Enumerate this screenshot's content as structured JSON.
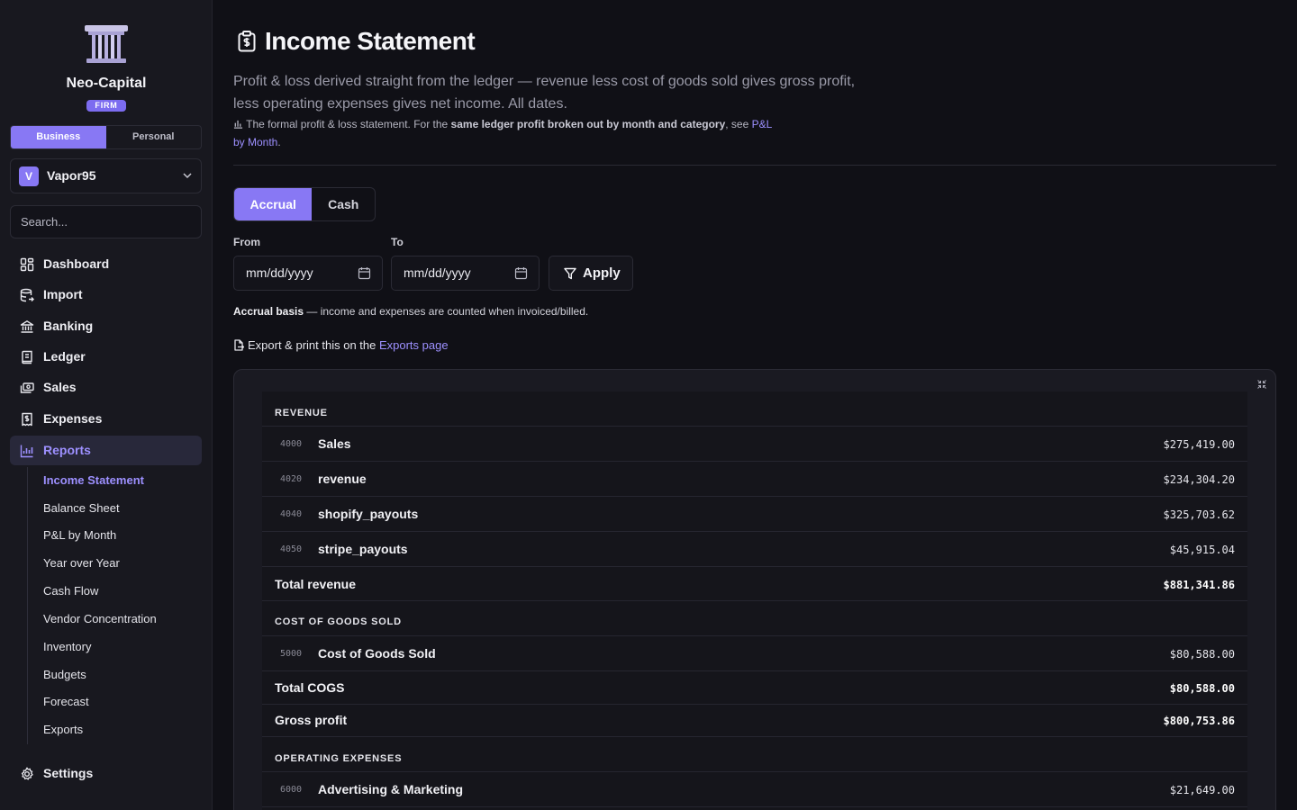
{
  "org": {
    "name": "Neo-Capital",
    "badge": "FIRM"
  },
  "mode_toggle": {
    "business": "Business",
    "personal": "Personal"
  },
  "account": {
    "initial": "V",
    "name": "Vapor95"
  },
  "search": {
    "placeholder": "Search..."
  },
  "nav": {
    "dashboard": "Dashboard",
    "import": "Import",
    "banking": "Banking",
    "ledger": "Ledger",
    "sales": "Sales",
    "expenses": "Expenses",
    "reports": "Reports",
    "settings": "Settings"
  },
  "reports_sub": {
    "income_statement": "Income Statement",
    "balance_sheet": "Balance Sheet",
    "pl_by_month": "P&L by Month",
    "year_over_year": "Year over Year",
    "cash_flow": "Cash Flow",
    "vendor_concentration": "Vendor Concentration",
    "inventory": "Inventory",
    "budgets": "Budgets",
    "forecast": "Forecast",
    "exports": "Exports"
  },
  "page": {
    "title": "Income Statement",
    "description": "Profit & loss derived straight from the ledger — revenue less cost of goods sold gives gross profit, less operating expenses gives net income. All dates.",
    "note_prefix": "The formal profit & loss statement. For the ",
    "note_bold": "same ledger profit broken out by month and category",
    "note_mid": ", see ",
    "note_link": "P&L by Month",
    "note_end": "."
  },
  "basis": {
    "accrual": "Accrual",
    "cash": "Cash"
  },
  "filters": {
    "from_label": "From",
    "to_label": "To",
    "from_value": "mm/dd/yyyy",
    "to_value": "mm/dd/yyyy",
    "apply": "Apply"
  },
  "basis_note": {
    "bold": "Accrual basis",
    "rest": " — income and expenses are counted when invoiced/billed."
  },
  "export": {
    "text": "Export & print this on the ",
    "link": "Exports page"
  },
  "statement": {
    "revenue": {
      "label": "REVENUE",
      "lines": [
        {
          "code": "4000",
          "name": "Sales",
          "amount": "$275,419.00"
        },
        {
          "code": "4020",
          "name": "revenue",
          "amount": "$234,304.20"
        },
        {
          "code": "4040",
          "name": "shopify_payouts",
          "amount": "$325,703.62"
        },
        {
          "code": "4050",
          "name": "stripe_payouts",
          "amount": "$45,915.04"
        }
      ],
      "total_label": "Total revenue",
      "total": "$881,341.86"
    },
    "cogs": {
      "label": "COST OF GOODS SOLD",
      "lines": [
        {
          "code": "5000",
          "name": "Cost of Goods Sold",
          "amount": "$80,588.00"
        }
      ],
      "total_label": "Total COGS",
      "total": "$80,588.00"
    },
    "gross_profit": {
      "label": "Gross profit",
      "amount": "$800,753.86"
    },
    "opex": {
      "label": "OPERATING EXPENSES",
      "lines": [
        {
          "code": "6000",
          "name": "Advertising & Marketing",
          "amount": "$21,649.00"
        }
      ]
    }
  }
}
